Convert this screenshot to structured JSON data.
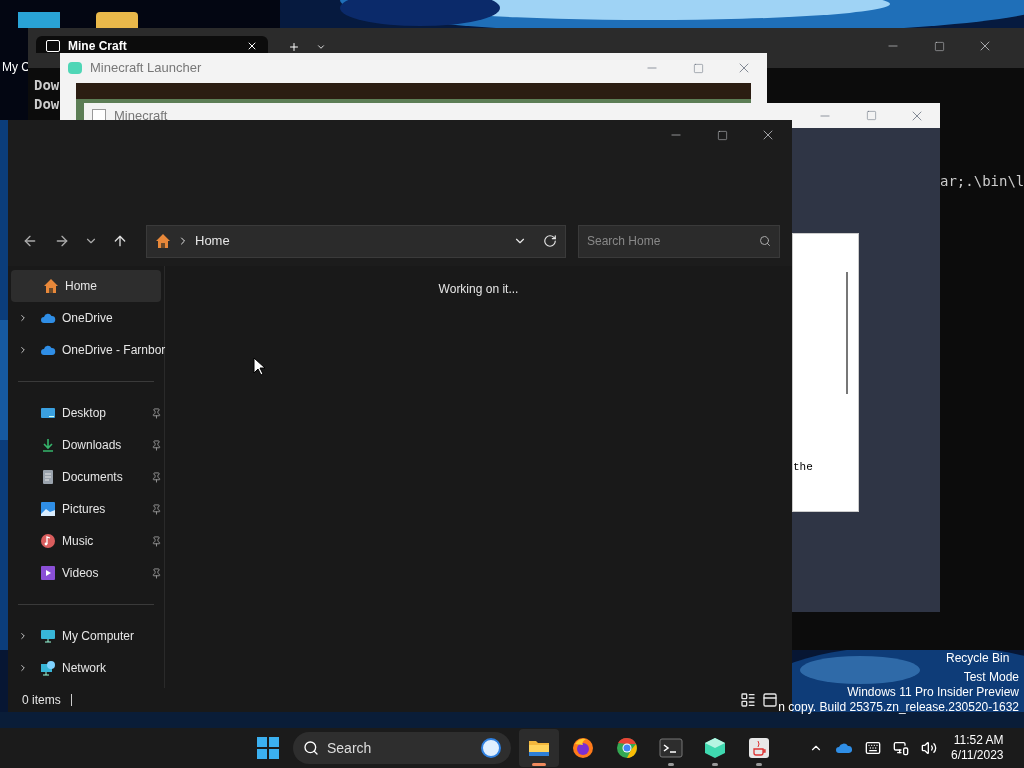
{
  "desktop": {
    "icon_labels": [
      "My C"
    ],
    "recycle_bin": "Recycle Bin",
    "watermark": [
      "Test Mode",
      "Windows 11 Pro Insider Preview",
      "n copy. Build 25375.zn_release.230520-1632"
    ]
  },
  "terminal": {
    "tab_title": "Mine Craft",
    "left_lines": [
      "Dow",
      "Dow"
    ],
    "right_line": "ar;.\\bin\\l"
  },
  "launcher": {
    "title": "Minecraft Launcher"
  },
  "minecraft": {
    "title": "Minecraft",
    "panel_text": "the"
  },
  "explorer": {
    "address": "Home",
    "search_placeholder": "Search Home",
    "message": "Working on it...",
    "status": "0 items",
    "sidebar_groups": [
      [
        {
          "label": "Home",
          "kind": "home",
          "selected": true,
          "expandable": false,
          "pinned": false
        },
        {
          "label": "OneDrive",
          "kind": "cloud",
          "selected": false,
          "expandable": true,
          "pinned": false
        },
        {
          "label": "OneDrive - Farnbor",
          "kind": "cloud",
          "selected": false,
          "expandable": true,
          "pinned": false
        }
      ],
      [
        {
          "label": "Desktop",
          "kind": "desktop",
          "selected": false,
          "expandable": false,
          "pinned": true
        },
        {
          "label": "Downloads",
          "kind": "download",
          "selected": false,
          "expandable": false,
          "pinned": true
        },
        {
          "label": "Documents",
          "kind": "document",
          "selected": false,
          "expandable": false,
          "pinned": true
        },
        {
          "label": "Pictures",
          "kind": "pictures",
          "selected": false,
          "expandable": false,
          "pinned": true
        },
        {
          "label": "Music",
          "kind": "music",
          "selected": false,
          "expandable": false,
          "pinned": true
        },
        {
          "label": "Videos",
          "kind": "videos",
          "selected": false,
          "expandable": false,
          "pinned": true
        }
      ],
      [
        {
          "label": "My Computer",
          "kind": "computer",
          "selected": false,
          "expandable": true,
          "pinned": false
        },
        {
          "label": "Network",
          "kind": "network",
          "selected": false,
          "expandable": true,
          "pinned": false
        }
      ]
    ]
  },
  "taskbar": {
    "search": "Search",
    "apps": [
      {
        "kind": "folder",
        "selected": true,
        "running": true
      },
      {
        "kind": "firefox",
        "selected": false,
        "running": false
      },
      {
        "kind": "chrome",
        "selected": false,
        "running": false
      },
      {
        "kind": "terminal",
        "selected": false,
        "running": true
      },
      {
        "kind": "cube",
        "selected": false,
        "running": true
      },
      {
        "kind": "java",
        "selected": false,
        "running": true
      }
    ],
    "time": "11:52 AM",
    "date": "6/11/2023"
  }
}
